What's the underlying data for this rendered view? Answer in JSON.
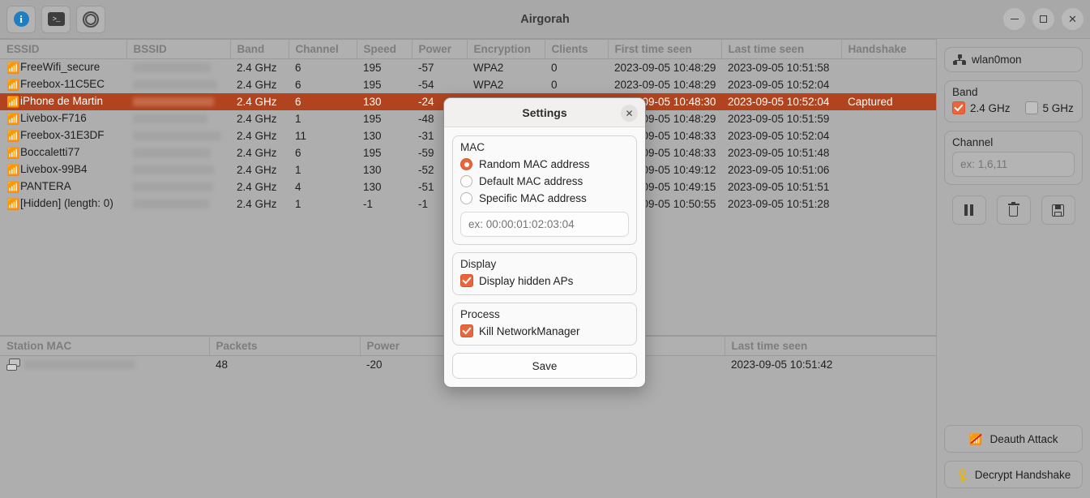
{
  "window": {
    "title": "Airgorah",
    "toolbar": [
      {
        "name": "info-icon",
        "glyph": "i"
      },
      {
        "name": "terminal-icon",
        "glyph": ">_"
      },
      {
        "name": "scan-target-icon",
        "glyph": ""
      }
    ],
    "controls": {
      "minimize": "–",
      "maximize": "□",
      "close": "✕"
    }
  },
  "ap_table": {
    "columns": [
      "ESSID",
      "BSSID",
      "Band",
      "Channel",
      "Speed",
      "Power",
      "Encryption",
      "Clients",
      "First time seen",
      "Last time seen",
      "Handshake"
    ],
    "rows": [
      {
        "essid": "FreeWifi_secure",
        "bssid": "",
        "band": "2.4 GHz",
        "channel": "6",
        "speed": "195",
        "power": "-57",
        "encryption": "WPA2",
        "clients": "0",
        "first_seen": "2023-09-05 10:48:29",
        "last_seen": "2023-09-05 10:51:58",
        "handshake": "",
        "selected": false
      },
      {
        "essid": "Freebox-11C5EC",
        "bssid": "",
        "band": "2.4 GHz",
        "channel": "6",
        "speed": "195",
        "power": "-54",
        "encryption": "WPA2",
        "clients": "0",
        "first_seen": "2023-09-05 10:48:29",
        "last_seen": "2023-09-05 10:52:04",
        "handshake": "",
        "selected": false
      },
      {
        "essid": "iPhone de Martin",
        "bssid": "",
        "band": "2.4 GHz",
        "channel": "6",
        "speed": "130",
        "power": "-24",
        "encryption": "",
        "clients": "",
        "first_seen": "2023-09-05 10:48:30",
        "last_seen": "2023-09-05 10:52:04",
        "handshake": "Captured",
        "selected": true
      },
      {
        "essid": "Livebox-F716",
        "bssid": "",
        "band": "2.4 GHz",
        "channel": "1",
        "speed": "195",
        "power": "-48",
        "encryption": "",
        "clients": "",
        "first_seen": "2023-09-05 10:48:29",
        "last_seen": "2023-09-05 10:51:59",
        "handshake": "",
        "selected": false
      },
      {
        "essid": "Freebox-31E3DF",
        "bssid": "",
        "band": "2.4 GHz",
        "channel": "11",
        "speed": "130",
        "power": "-31",
        "encryption": "",
        "clients": "",
        "first_seen": "2023-09-05 10:48:33",
        "last_seen": "2023-09-05 10:52:04",
        "handshake": "",
        "selected": false
      },
      {
        "essid": "Boccaletti77",
        "bssid": "",
        "band": "2.4 GHz",
        "channel": "6",
        "speed": "195",
        "power": "-59",
        "encryption": "",
        "clients": "",
        "first_seen": "2023-09-05 10:48:33",
        "last_seen": "2023-09-05 10:51:48",
        "handshake": "",
        "selected": false
      },
      {
        "essid": "Livebox-99B4",
        "bssid": "",
        "band": "2.4 GHz",
        "channel": "1",
        "speed": "130",
        "power": "-52",
        "encryption": "",
        "clients": "",
        "first_seen": "2023-09-05 10:49:12",
        "last_seen": "2023-09-05 10:51:06",
        "handshake": "",
        "selected": false
      },
      {
        "essid": "PANTERA",
        "bssid": "",
        "band": "2.4 GHz",
        "channel": "4",
        "speed": "130",
        "power": "-51",
        "encryption": "",
        "clients": "",
        "first_seen": "2023-09-05 10:49:15",
        "last_seen": "2023-09-05 10:51:51",
        "handshake": "",
        "selected": false
      },
      {
        "essid": "[Hidden] (length: 0)",
        "bssid": "",
        "band": "2.4 GHz",
        "channel": "1",
        "speed": "-1",
        "power": "-1",
        "encryption": "",
        "clients": "",
        "first_seen": "2023-09-05 10:50:55",
        "last_seen": "2023-09-05 10:51:28",
        "handshake": "",
        "selected": false
      }
    ]
  },
  "station_table": {
    "columns": [
      "Station MAC",
      "Packets",
      "Power",
      "",
      "Last time seen"
    ],
    "rows": [
      {
        "mac": "",
        "packets": "48",
        "power": "-20",
        "blank": "",
        "last_seen": "2023-09-05 10:51:42"
      }
    ]
  },
  "sidebar": {
    "interface": "wlan0mon",
    "band": {
      "title": "Band",
      "options": [
        {
          "label": "2.4 GHz",
          "checked": true
        },
        {
          "label": "5 GHz",
          "checked": false
        }
      ]
    },
    "channel": {
      "title": "Channel",
      "placeholder": "ex: 1,6,11",
      "value": ""
    },
    "actions": [
      {
        "name": "pause-scan-button",
        "icon": "pause-icon"
      },
      {
        "name": "clear-button",
        "icon": "trash-icon"
      },
      {
        "name": "save-button",
        "icon": "floppy-save-icon"
      }
    ],
    "deauth_label": "Deauth Attack",
    "decrypt_label": "Decrypt Handshake"
  },
  "settings_dialog": {
    "title": "Settings",
    "close": "✕",
    "mac": {
      "title": "MAC",
      "options": [
        {
          "label": "Random MAC address",
          "selected": true
        },
        {
          "label": "Default MAC address",
          "selected": false
        },
        {
          "label": "Specific MAC address",
          "selected": false
        }
      ],
      "placeholder": "ex: 00:00:01:02:03:04",
      "value": ""
    },
    "display": {
      "title": "Display",
      "checkbox": {
        "label": "Display hidden APs",
        "checked": true
      }
    },
    "process": {
      "title": "Process",
      "checkbox": {
        "label": "Kill NetworkManager",
        "checked": true
      }
    },
    "save_label": "Save"
  },
  "colors": {
    "accent": "#e8663c",
    "selection": "#b1441f",
    "info": "#1d7ec4",
    "chrome": "#aeaeae"
  }
}
